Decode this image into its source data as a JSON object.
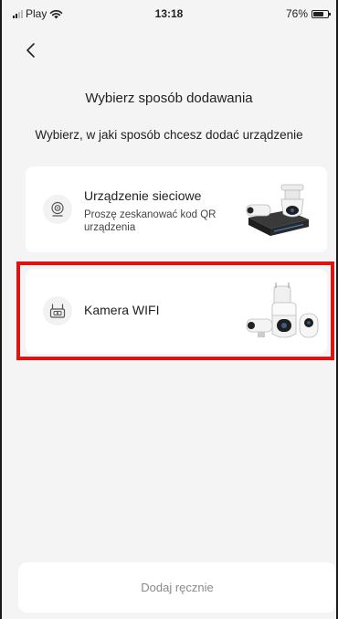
{
  "status_bar": {
    "carrier": "Play",
    "time": "13:18",
    "battery": "76%",
    "battery_level": 0.76,
    "icons": [
      "signal-icon",
      "wifi-icon",
      "battery-icon"
    ]
  },
  "header": {
    "back_icon": "chevron-left-icon",
    "title": "Wybierz sposób dodawania",
    "subtitle": "Wybierz, w jaki sposób chcesz dodać urządzenie"
  },
  "options": [
    {
      "icon": "network-device-icon",
      "title": "Urządzenie sieciowe",
      "description": "Proszę zeskanować kod QR urządzenia",
      "image": "nvr-and-ptz-camera-image"
    },
    {
      "icon": "wifi-camera-icon",
      "title": "Kamera WIFI",
      "description": "",
      "image": "wifi-cameras-image"
    }
  ],
  "highlight_color": "#e11212",
  "manual_button": {
    "label": "Dodaj ręcznie"
  }
}
